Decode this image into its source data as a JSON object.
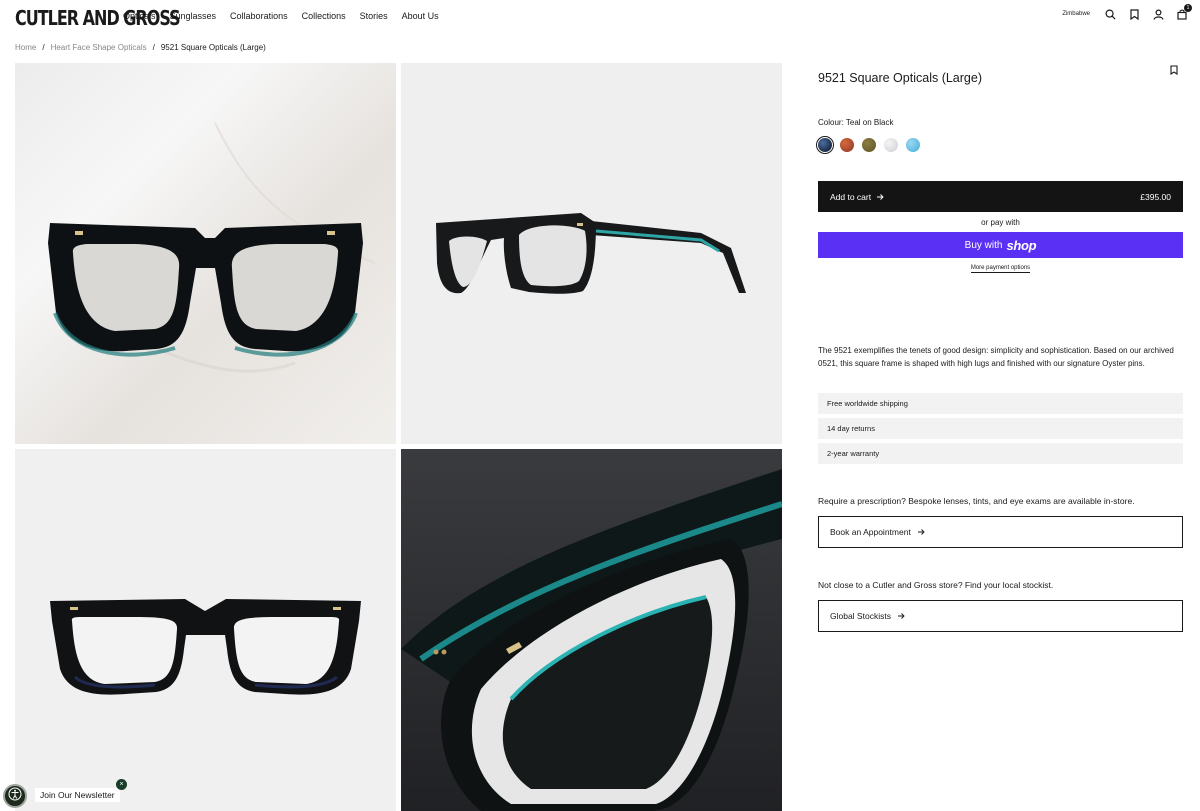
{
  "header": {
    "logo": "CUTLER AND GROSS",
    "nav": [
      "Opticals",
      "Sunglasses",
      "Collaborations",
      "Collections",
      "Stories",
      "About Us"
    ],
    "region": "Zimbabwe",
    "cart_count": "1",
    "icons": [
      "search-icon",
      "bookmark-icon",
      "account-icon",
      "bag-icon"
    ]
  },
  "breadcrumb": {
    "home": "Home",
    "category": "Heart Face Shape Opticals",
    "current": "9521 Square Opticals (Large)",
    "separator": "/"
  },
  "product": {
    "title": "9521 Square Opticals (Large)",
    "colour_label": "Colour:",
    "colour_value": "Teal on Black",
    "swatches": [
      {
        "color": "#1d2c45",
        "selected": true
      },
      {
        "color": "#a0452a",
        "selected": false
      },
      {
        "color": "#6b6030",
        "selected": false
      },
      {
        "color": "#e3e3e7",
        "selected": false
      },
      {
        "color": "#6ec3e6",
        "selected": false
      }
    ],
    "add_to_cart": "Add to cart",
    "price": "£395.00",
    "or_pay": "or pay with",
    "buy_with": "Buy with",
    "shop": "shop",
    "more_payment": "More payment options",
    "description": "The 9521 exemplifies the tenets of good design: simplicity and sophistication. Based on our archived 0521, this square frame is shaped with high lugs and finished with our signature Oyster pins.",
    "perks": [
      "Free worldwide shipping",
      "14 day returns",
      "2-year warranty"
    ],
    "prescription_text": "Require a prescription? Bespoke lenses, tints, and eye exams are available in-store.",
    "book_button": "Book an Appointment",
    "stockist_text": "Not close to a Cutler and Gross store? Find your local stockist.",
    "stockist_button": "Global Stockists"
  },
  "newsletter": {
    "label": "Join Our Newsletter",
    "close": "×"
  },
  "colors": {
    "shop_pay": "#5a31f4",
    "button_dark": "#141414",
    "perk_bg": "#f2f2f2"
  }
}
